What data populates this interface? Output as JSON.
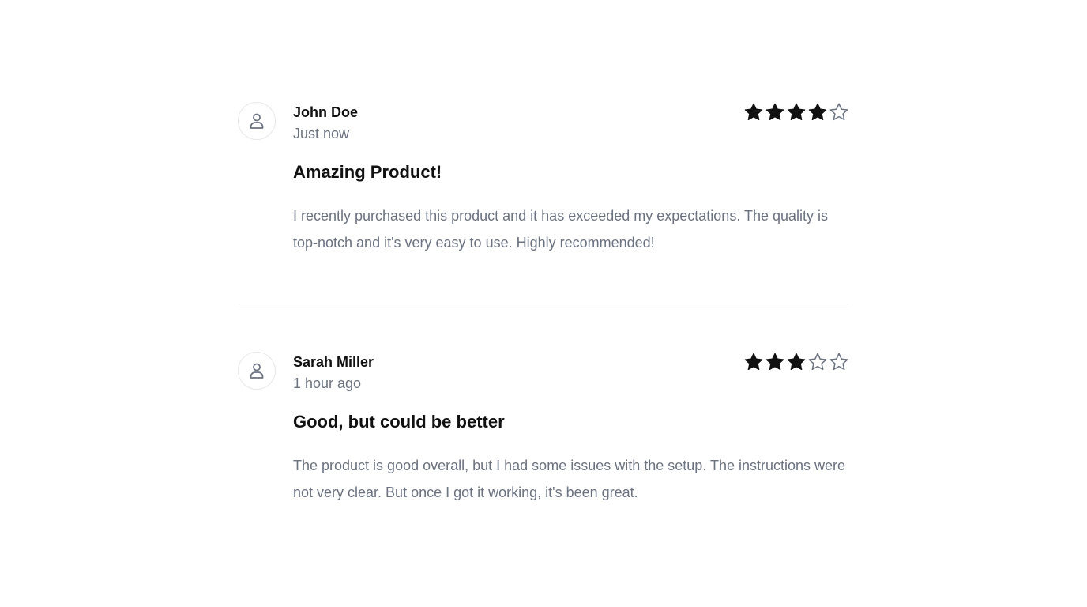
{
  "reviews": [
    {
      "author": "John Doe",
      "time": "Just now",
      "rating": 4,
      "max_rating": 5,
      "title": "Amazing Product!",
      "body": "I recently purchased this product and it has exceeded my expectations. The quality is top-notch and it's very easy to use. Highly recommended!"
    },
    {
      "author": "Sarah Miller",
      "time": "1 hour ago",
      "rating": 3,
      "max_rating": 5,
      "title": "Good, but could be better",
      "body": "The product is good overall, but I had some issues with the setup. The instructions were not very clear. But once I got it working, it's been great."
    }
  ],
  "icons": {
    "avatar": "user-icon",
    "star_filled": "star-filled-icon",
    "star_empty": "star-outline-icon"
  },
  "colors": {
    "star_filled": "#111111",
    "star_empty": "#6b7280",
    "muted_text": "#6b7280",
    "heading_text": "#111111",
    "divider": "#eeeeee"
  }
}
